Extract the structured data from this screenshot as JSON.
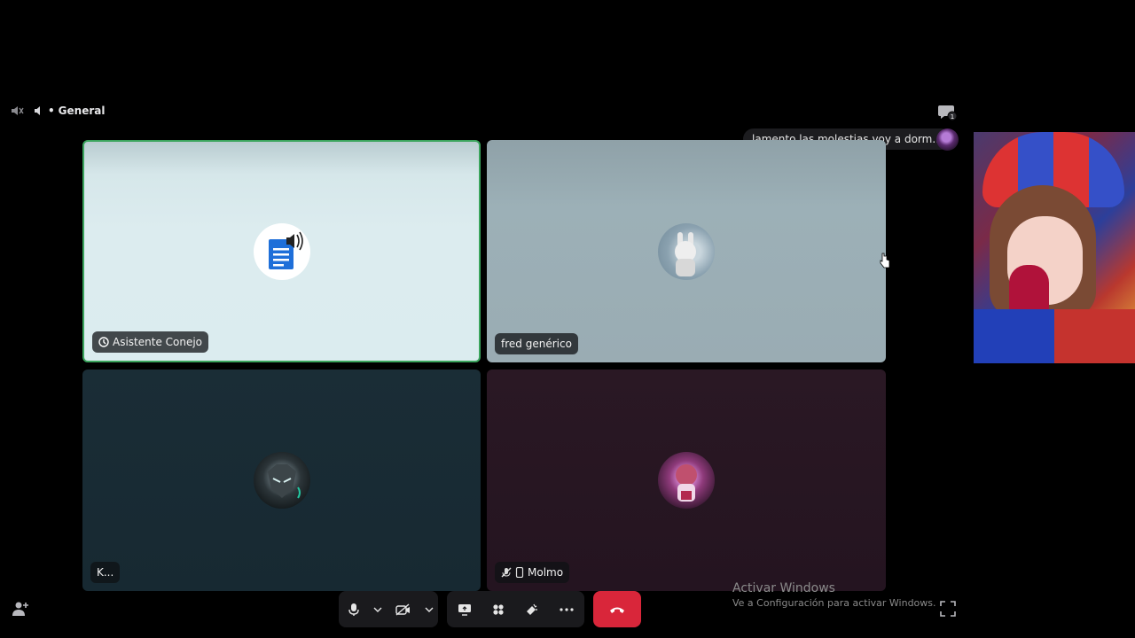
{
  "header": {
    "channel_name": "General",
    "channel_prefix": "•"
  },
  "toast": {
    "message": "lamento las molestias voy a dorm..."
  },
  "participants": [
    {
      "name": "Asistente Conejo",
      "speaking": true,
      "accent": "#3ba55d",
      "icon": "bot-badge-icon"
    },
    {
      "name": "fred genérico",
      "speaking": false
    },
    {
      "name": "K...",
      "speaking": false
    },
    {
      "name": "Molmo",
      "speaking": false,
      "icons": [
        "mic-muted-icon",
        "mobile-icon"
      ]
    }
  ],
  "controls": {
    "left_group": [
      "microphone-icon",
      "chevron-down-icon",
      "camera-off-icon",
      "chevron-down-icon"
    ],
    "right_group": [
      "screen-share-icon",
      "activities-icon",
      "soundboard-icon",
      "more-icon"
    ],
    "end_call": "phone-hangup-icon",
    "end_call_color": "#d9263a"
  },
  "watermark": {
    "title": "Activar Windows",
    "subtitle": "Ve a Configuración para activar Windows."
  }
}
